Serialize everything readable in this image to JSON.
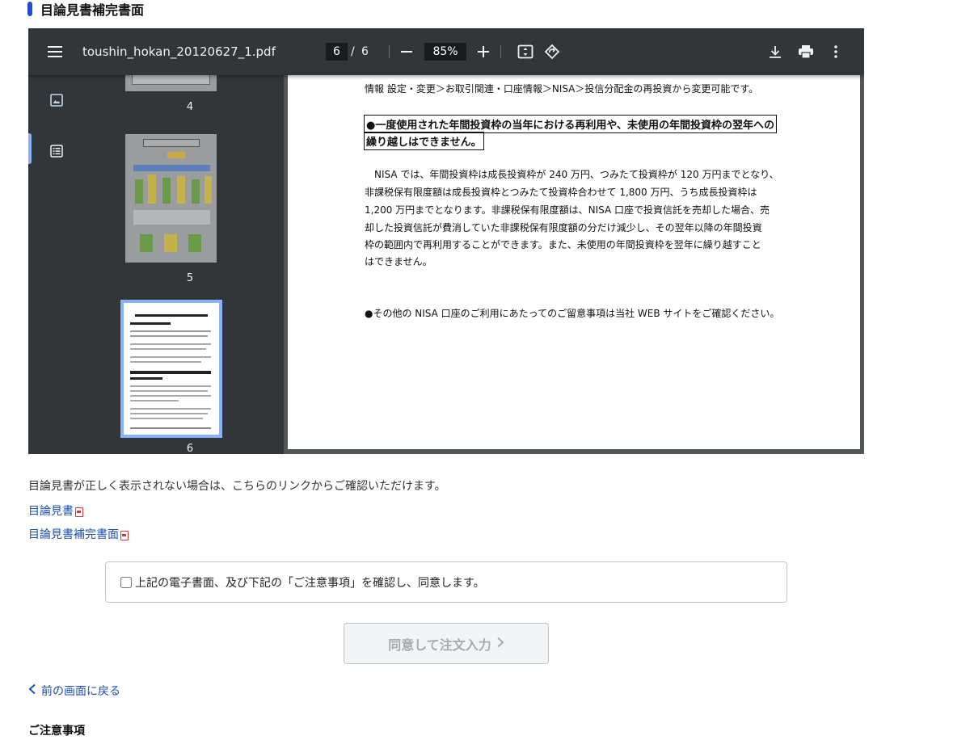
{
  "section_title": "目論見書補完書面",
  "viewer": {
    "filename": "toushin_hokan_20120627_1.pdf",
    "current_page": "6",
    "page_separator": "/",
    "total_pages": "6",
    "zoom": "85%",
    "thumbnails": [
      {
        "label": "4"
      },
      {
        "label": "5"
      },
      {
        "label": "6"
      }
    ],
    "page_content": {
      "line1": "情報 設定・変更＞お取引関連・口座情報＞NISA＞投信分配金の再投資から変更可能です。",
      "boxed1": "●一度使用された年間投資枠の当年における再利用や、未使用の年間投資枠の翌年への",
      "boxed2": "繰り越しはできません。",
      "para": [
        "　NISA では、年間投資枠は成長投資枠が 240 万円、つみたて投資枠が 120 万円までとなり、",
        "非課税保有限度額は成長投資枠とつみたて投資枠合わせて 1,800 万円、うち成長投資枠は",
        "1,200 万円までとなります。非課税保有限度額は、NISA 口座で投資信託を売却した場合、売",
        "却した投資信託が費消していた非課税保有限度額の分だけ減少し、その翌年以降の年間投資",
        "枠の範囲内で再利用することができます。また、未使用の年間投資枠を翌年に繰り越すこと",
        "はできません。"
      ],
      "last_line": "●その他の NISA 口座のご利用にあたってのご留意事項は当社 WEB サイトをご確認ください。"
    }
  },
  "note": "目論見書が正しく表示されない場合は、こちらのリンクからご確認いただけます。",
  "links": {
    "prospectus": "目論見書",
    "supplement": "目論見書補完書面"
  },
  "agree_label": "上記の電子書面、及び下記の「ご注意事項」を確認し、同意します。",
  "submit_label": "同意して注文入力",
  "submit_chevron": "＞",
  "back_label": "前の画面に戻る",
  "caution_title": "ご注意事項",
  "colors": {
    "accent": "#1f4fd0",
    "link": "#1a4fb0",
    "viewer_toolbar": "#323639",
    "viewer_bg": "#525659",
    "thumb_highlight": "#8ab4f8"
  }
}
